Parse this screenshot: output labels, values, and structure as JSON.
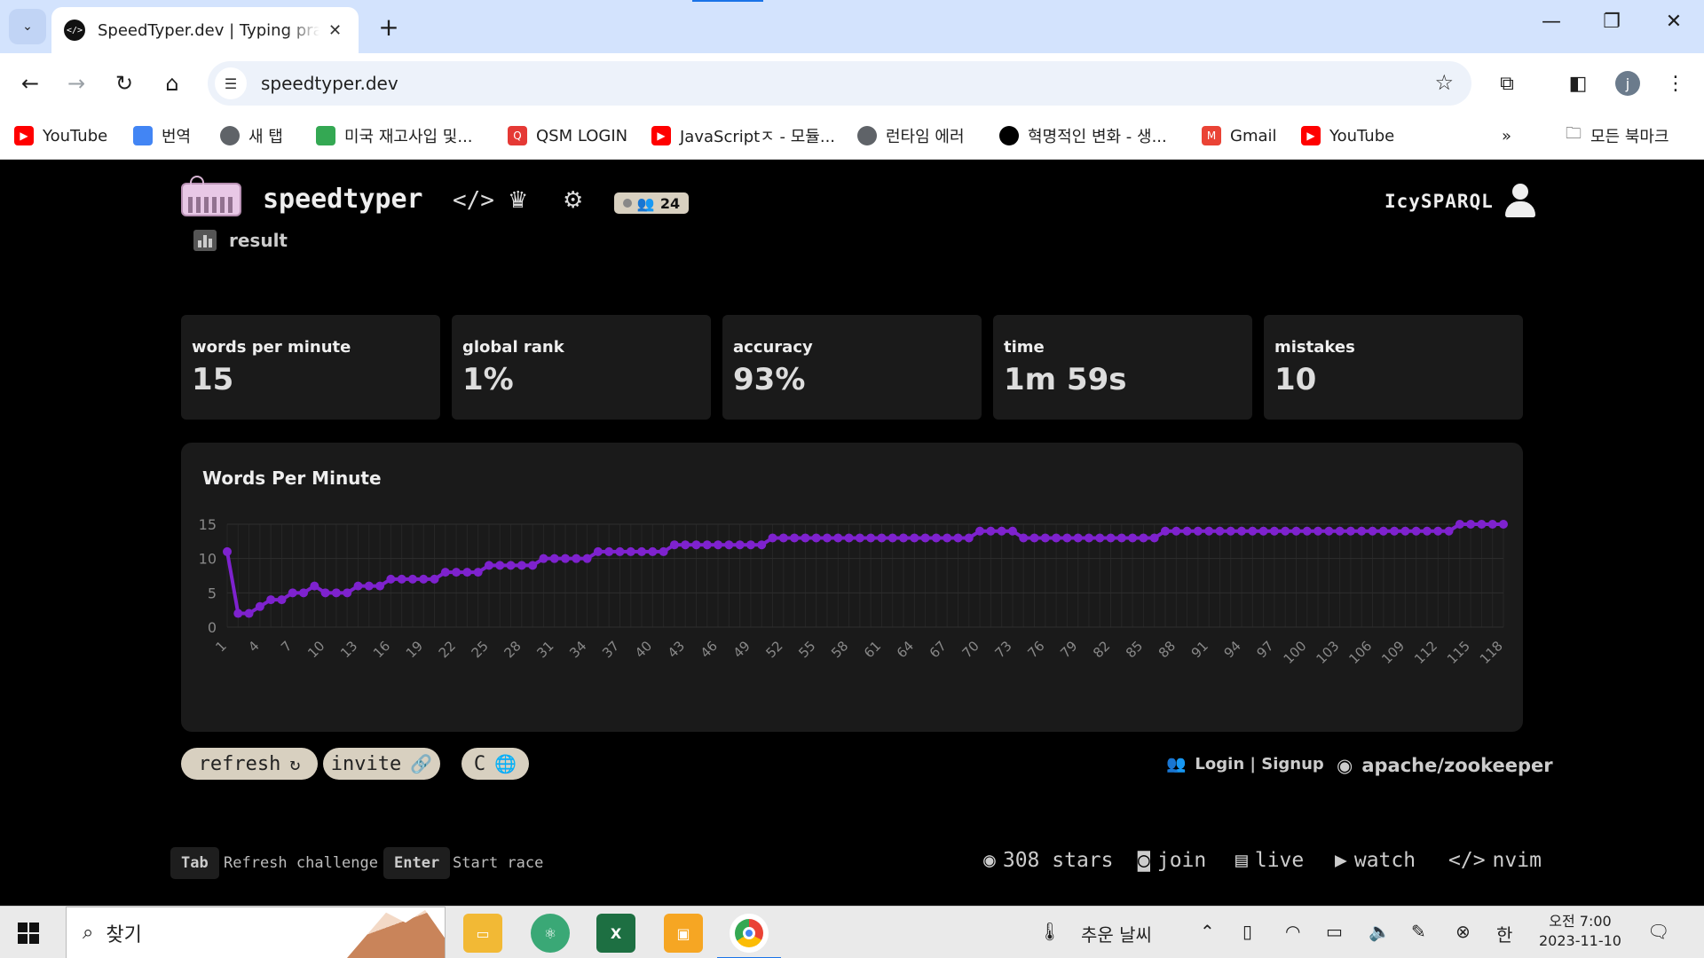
{
  "browser": {
    "tab_title": "SpeedTyper.dev | Typing practice",
    "url": "speedtyper.dev",
    "bookmarks": [
      {
        "label": "YouTube",
        "icon": "youtube-icon",
        "color": "#ff0000"
      },
      {
        "label": "번역",
        "icon": "translate-icon",
        "color": "#4285f4"
      },
      {
        "label": "새 탭",
        "icon": "globe-icon",
        "color": "#5f6368"
      },
      {
        "label": "미국 재고사입 및...",
        "icon": "cup-icon",
        "color": "#34a853"
      },
      {
        "label": "QSM LOGIN",
        "icon": "qsm-icon",
        "color": "#e53935"
      },
      {
        "label": "JavaScriptㅈ - 모듈...",
        "icon": "youtube-icon",
        "color": "#ff0000"
      },
      {
        "label": "런타임 에러",
        "icon": "globe-icon",
        "color": "#5f6368"
      },
      {
        "label": "혁명적인 변화 - 생...",
        "icon": "circle-icon",
        "color": "#000000"
      },
      {
        "label": "Gmail",
        "icon": "gmail-icon",
        "color": "#ea4335"
      },
      {
        "label": "YouTube",
        "icon": "youtube-icon",
        "color": "#ff0000"
      }
    ],
    "all_bookmarks": "모든 북마크",
    "profile_initial": "j"
  },
  "header": {
    "brand": "speedtyper",
    "online_count": "24",
    "username": "IcySPARQL"
  },
  "result": {
    "label": "result",
    "stats": [
      {
        "label": "words per minute",
        "value": "15"
      },
      {
        "label": "global rank",
        "value": "1%"
      },
      {
        "label": "accuracy",
        "value": "93%"
      },
      {
        "label": "time",
        "value": "1m 59s"
      },
      {
        "label": "mistakes",
        "value": "10"
      }
    ]
  },
  "chart_data": {
    "type": "line",
    "title": "Words Per Minute",
    "ylim": [
      0,
      15
    ],
    "yticks": [
      0,
      5,
      10,
      15
    ],
    "x_tick_labels": [
      "1",
      "4",
      "7",
      "10",
      "13",
      "16",
      "19",
      "22",
      "25",
      "28",
      "31",
      "34",
      "37",
      "40",
      "43",
      "46",
      "49",
      "52",
      "55",
      "58",
      "61",
      "64",
      "67",
      "70",
      "73",
      "76",
      "79",
      "82",
      "85",
      "88",
      "91",
      "94",
      "97",
      "100",
      "103",
      "106",
      "109",
      "112",
      "115",
      "118"
    ],
    "series": [
      {
        "color": "#7e22ce",
        "x": [
          1,
          2,
          3,
          4,
          5,
          6,
          7,
          8,
          9,
          10,
          11,
          12,
          13,
          14,
          15,
          16,
          17,
          18,
          19,
          20,
          21,
          22,
          23,
          24,
          25,
          26,
          27,
          28,
          29,
          30,
          31,
          32,
          33,
          34,
          35,
          36,
          37,
          38,
          39,
          40,
          41,
          42,
          43,
          44,
          45,
          46,
          47,
          48,
          49,
          50,
          51,
          52,
          53,
          54,
          55,
          56,
          57,
          58,
          59,
          60,
          61,
          62,
          63,
          64,
          65,
          66,
          67,
          68,
          69,
          70,
          71,
          72,
          73,
          74,
          75,
          76,
          77,
          78,
          79,
          80,
          81,
          82,
          83,
          84,
          85,
          86,
          87,
          88,
          89,
          90,
          91,
          92,
          93,
          94,
          95,
          96,
          97,
          98,
          99,
          100,
          101,
          102,
          103,
          104,
          105,
          106,
          107,
          108,
          109,
          110,
          111,
          112,
          113,
          114,
          115,
          116,
          117,
          118
        ],
        "values": [
          11,
          2,
          2,
          3,
          4,
          4,
          5,
          5,
          6,
          5,
          5,
          5,
          6,
          6,
          6,
          7,
          7,
          7,
          7,
          7,
          8,
          8,
          8,
          8,
          9,
          9,
          9,
          9,
          9,
          10,
          10,
          10,
          10,
          10,
          11,
          11,
          11,
          11,
          11,
          11,
          11,
          12,
          12,
          12,
          12,
          12,
          12,
          12,
          12,
          12,
          13,
          13,
          13,
          13,
          13,
          13,
          13,
          13,
          13,
          13,
          13,
          13,
          13,
          13,
          13,
          13,
          13,
          13,
          13,
          14,
          14,
          14,
          14,
          13,
          13,
          13,
          13,
          13,
          13,
          13,
          13,
          13,
          13,
          13,
          13,
          13,
          14,
          14,
          14,
          14,
          14,
          14,
          14,
          14,
          14,
          14,
          14,
          14,
          14,
          14,
          14,
          14,
          14,
          14,
          14,
          14,
          14,
          14,
          14,
          14,
          14,
          14,
          14,
          15,
          15,
          15,
          15,
          15
        ]
      }
    ],
    "grid": true
  },
  "actions": {
    "refresh": "refresh",
    "invite": "invite",
    "language": "C",
    "login": "Login | Signup",
    "repo": "apache/zookeeper"
  },
  "footer": {
    "tab_key": "Tab",
    "tab_desc": "Refresh challenge",
    "enter_key": "Enter",
    "enter_desc": "Start race",
    "stars": "308 stars",
    "join": "join",
    "live": "live",
    "watch": "watch",
    "nvim": "nvim"
  },
  "taskbar": {
    "search_placeholder": "찾기",
    "weather": "추운 날씨",
    "ime": "한",
    "time": "오전 7:00",
    "date": "2023-11-10"
  }
}
